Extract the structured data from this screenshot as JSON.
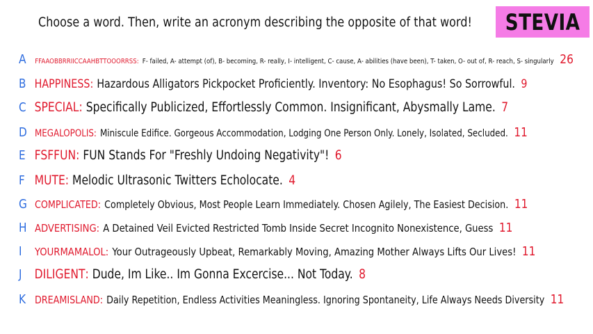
{
  "prompt": "Choose a word. Then, write an acronym describing the opposite of that word!",
  "name_badge": "STEVIA",
  "colors": {
    "letter": "#2d6cdf",
    "word": "#e0192d",
    "count": "#e0192d",
    "text": "#111111",
    "badge_bg": "#f57ce6"
  },
  "entries": [
    {
      "letter": "A",
      "word": "FFAAOBBRRIICCAAHBTTOOORRSS",
      "acronym": "F- failed, A- attempt (of), B- becoming, R- really, I- intelligent, C- cause, A- abilities (have been), T- taken, O- out of, R- reach, S- singularly",
      "count": "26"
    },
    {
      "letter": "B",
      "word": "HAPPINESS",
      "acronym": "Hazardous Alligators Pickpocket Proficiently. Inventory: No Esophagus! So Sorrowful.",
      "count": "9"
    },
    {
      "letter": "C",
      "word": "SPECIAL",
      "acronym": "Specifically Publicized, Effortlessly Common. Insignificant, Abysmally Lame.",
      "count": "7"
    },
    {
      "letter": "D",
      "word": "MEGALOPOLIS",
      "acronym": "Miniscule Edifice. Gorgeous Accommodation, Lodging One Person Only. Lonely, Isolated, Secluded.",
      "count": "11"
    },
    {
      "letter": "E",
      "word": "FSFFUN",
      "acronym": "FUN Stands For \"Freshly Undoing Negativity\"!",
      "count": "6"
    },
    {
      "letter": "F",
      "word": "MUTE",
      "acronym": "Melodic Ultrasonic Twitters Echolocate.",
      "count": "4"
    },
    {
      "letter": "G",
      "word": "COMPLICATED",
      "acronym": "Completely Obvious, Most People Learn Immediately. Chosen Agilely, The Easiest Decision.",
      "count": "11"
    },
    {
      "letter": "H",
      "word": "ADVERTISING",
      "acronym": "A Detained Veil Evicted Restricted Tomb Inside Secret Incognito Nonexistence, Guess",
      "count": "11"
    },
    {
      "letter": "I",
      "word": "YOURMAMALOL",
      "acronym": "Your Outrageously Upbeat, Remarkably Moving, Amazing Mother Always Lifts Our Lives!",
      "count": "11"
    },
    {
      "letter": "J",
      "word": "DILIGENT",
      "acronym": "Dude, Im Like.. Im Gonna Excercise... Not Today.",
      "count": "8"
    },
    {
      "letter": "K",
      "word": "DREAMISLAND",
      "acronym": "Daily Repetition, Endless Activities Meaningless. Ignoring Spontaneity, Life Always Needs Diversity",
      "count": "11"
    }
  ]
}
